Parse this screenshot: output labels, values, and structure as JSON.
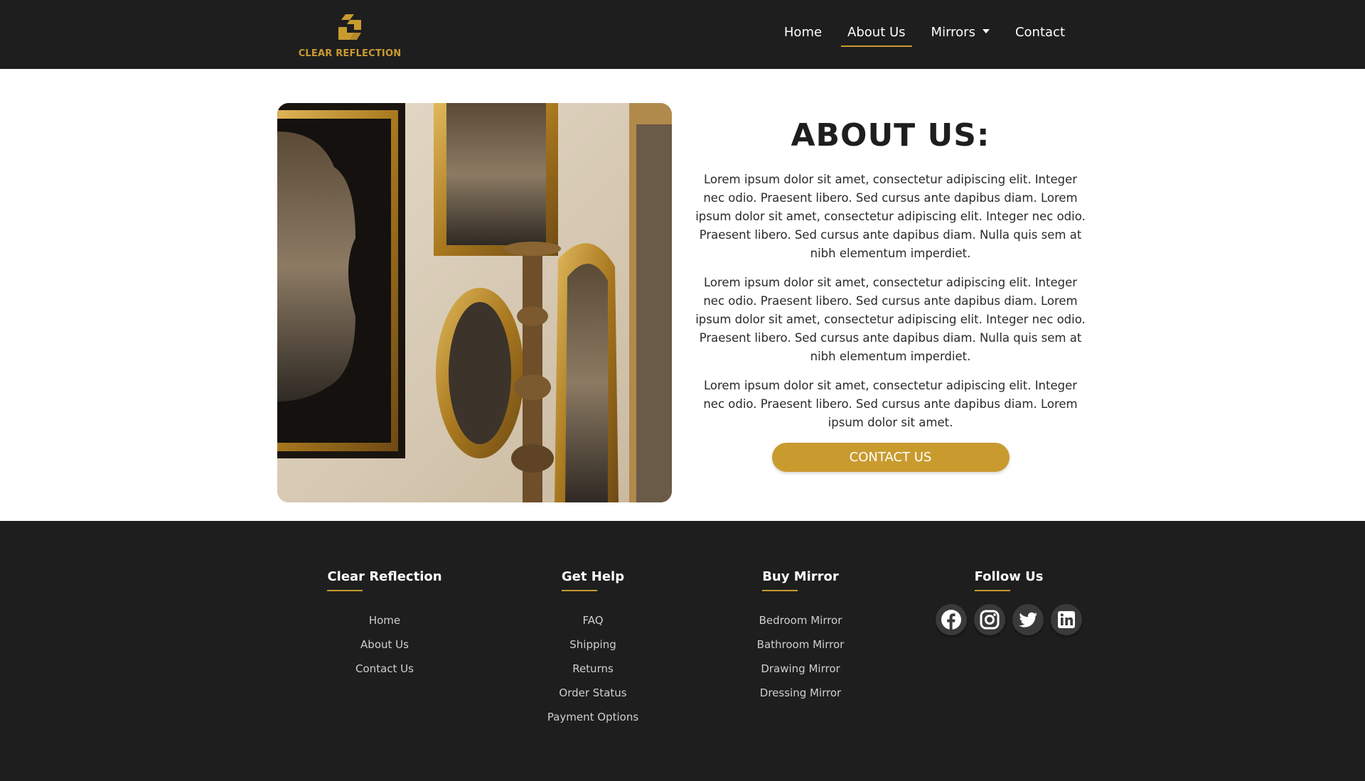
{
  "brand": {
    "name": "CLEAR REFLECTION",
    "accent": "#c99b2f",
    "dark": "#1e1e1e"
  },
  "nav": {
    "items": [
      {
        "label": "Home",
        "active": false
      },
      {
        "label": "About Us",
        "active": true
      },
      {
        "label": "Mirrors",
        "active": false,
        "dropdown": true
      },
      {
        "label": "Contact",
        "active": false
      }
    ]
  },
  "about": {
    "title": "ABOUT US:",
    "paragraphs": [
      "Lorem ipsum dolor sit amet, consectetur adipiscing elit. Integer nec odio. Praesent libero. Sed cursus ante dapibus diam. Lorem ipsum dolor sit amet, consectetur adipiscing elit. Integer nec odio. Praesent libero. Sed cursus ante dapibus diam. Nulla quis sem at nibh elementum imperdiet.",
      "Lorem ipsum dolor sit amet, consectetur adipiscing elit. Integer nec odio. Praesent libero. Sed cursus ante dapibus diam. Lorem ipsum dolor sit amet, consectetur adipiscing elit. Integer nec odio. Praesent libero. Sed cursus ante dapibus diam. Nulla quis sem at nibh elementum imperdiet.",
      "Lorem ipsum dolor sit amet, consectetur adipiscing elit. Integer nec odio. Praesent libero. Sed cursus ante dapibus diam. Lorem ipsum dolor sit amet."
    ],
    "cta_label": "CONTACT US"
  },
  "footer": {
    "columns": [
      {
        "title": "Clear Reflection",
        "links": [
          "Home",
          "About Us",
          "Contact Us"
        ]
      },
      {
        "title": "Get Help",
        "links": [
          "FAQ",
          "Shipping",
          "Returns",
          "Order Status",
          "Payment Options"
        ]
      },
      {
        "title": "Buy Mirror",
        "links": [
          "Bedroom Mirror",
          "Bathroom Mirror",
          "Drawing Mirror",
          "Dressing Mirror"
        ]
      }
    ],
    "follow": {
      "title": "Follow Us",
      "icons": [
        "facebook-icon",
        "instagram-icon",
        "twitter-icon",
        "linkedin-icon"
      ]
    }
  }
}
